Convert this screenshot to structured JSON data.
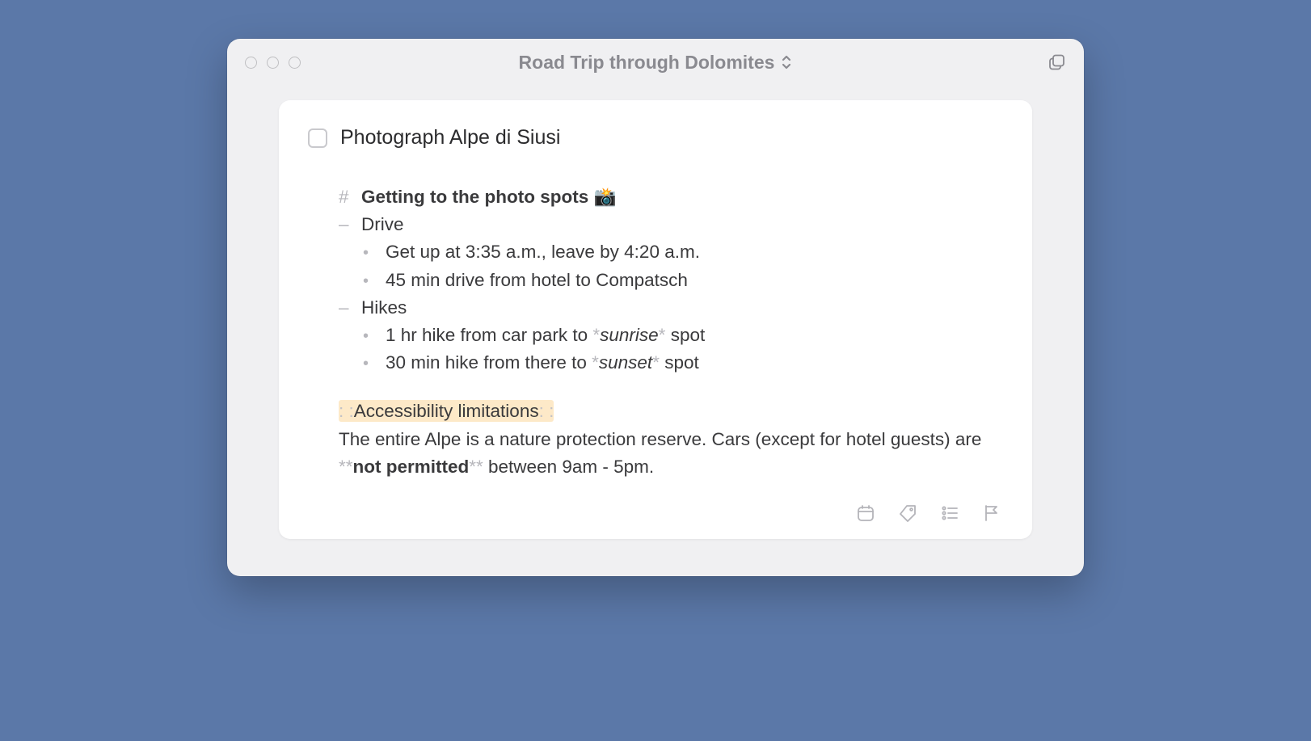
{
  "window": {
    "title": "Road Trip through Dolomites"
  },
  "task": {
    "checked": false,
    "title": "Photograph Alpe di Siusi"
  },
  "note": {
    "heading_marker": "#",
    "heading_text": "Getting to the photo spots",
    "heading_emoji": "📸",
    "sections": [
      {
        "label": "Drive",
        "items": [
          "Get up at 3:35 a.m., leave by 4:20 a.m.",
          "45 min drive from hotel to Compatsch"
        ]
      },
      {
        "label": "Hikes",
        "items_rich": [
          {
            "pre": "1 hr hike from car park to ",
            "em": "sunrise",
            "post": " spot"
          },
          {
            "pre": "30 min hike from there to ",
            "em": "sunset",
            "post": " spot"
          }
        ]
      }
    ],
    "highlight_marker": ": :",
    "highlight_text": "Accessibility limitations",
    "paragraph_pre": "The entire Alpe is a nature protection reserve. Cars (except for hotel guests) are ",
    "bold_marker": "**",
    "paragraph_bold": "not permitted",
    "paragraph_post": " between 9am - 5pm."
  },
  "markers": {
    "dash": "–",
    "bullet": "•",
    "star": "*"
  },
  "toolbar": {
    "calendar": "calendar-icon",
    "tag": "tag-icon",
    "checklist": "checklist-icon",
    "flag": "flag-icon"
  }
}
